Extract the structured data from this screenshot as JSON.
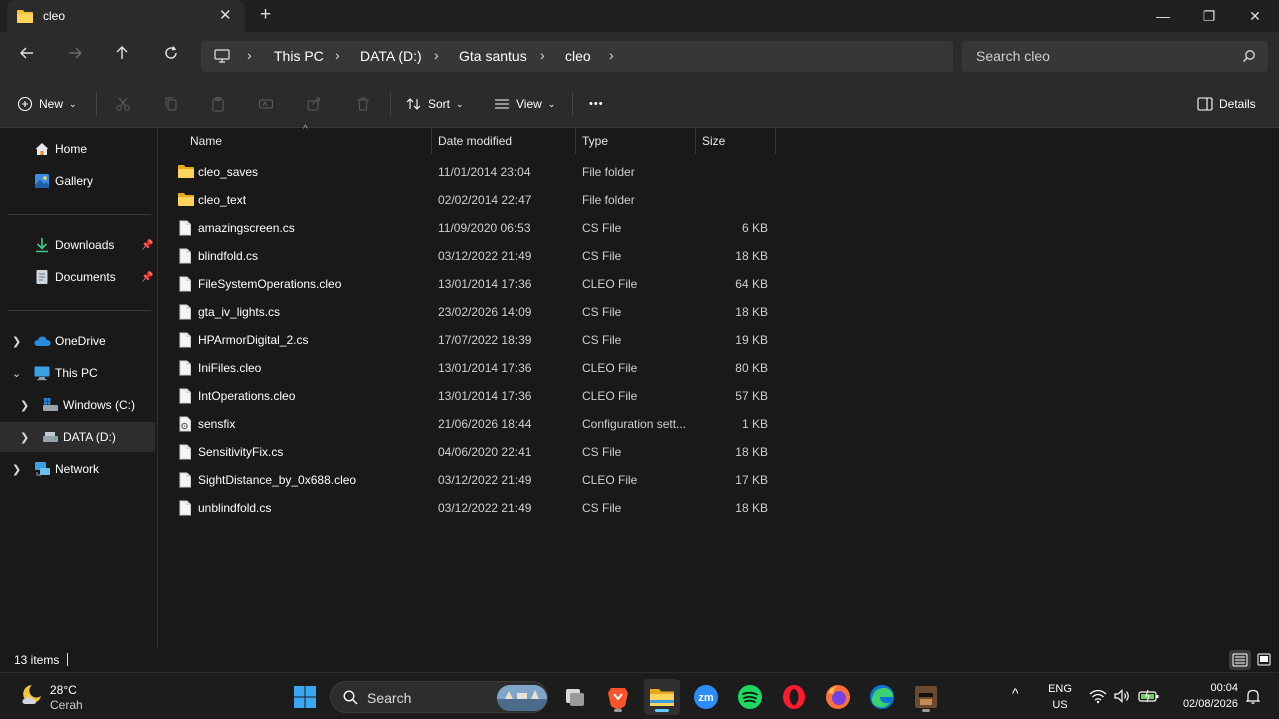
{
  "window": {
    "tab_title": "cleo",
    "new_tab_glyph": "+",
    "close_tab_glyph": "✕",
    "minimize_glyph": "—",
    "restore_glyph": "❐",
    "close_glyph": "✕"
  },
  "nav": {
    "breadcrumb": [
      "This PC",
      "DATA (D:)",
      "Gta santus",
      "cleo"
    ],
    "search_placeholder": "Search cleo"
  },
  "commands": {
    "new_label": "New",
    "sort_label": "Sort",
    "view_label": "View",
    "more_glyph": "•••",
    "details_label": "Details"
  },
  "sidebar": {
    "home": "Home",
    "gallery": "Gallery",
    "downloads": "Downloads",
    "documents": "Documents",
    "onedrive": "OneDrive",
    "thispc": "This PC",
    "windows_c": "Windows (C:)",
    "data_d": "DATA (D:)",
    "network": "Network"
  },
  "columns": {
    "name": "Name",
    "date": "Date modified",
    "type": "Type",
    "size": "Size"
  },
  "files": [
    {
      "name": "cleo_saves",
      "date": "11/01/2014 23:04",
      "type": "File folder",
      "size": "",
      "icon": "folder-icon"
    },
    {
      "name": "cleo_text",
      "date": "02/02/2014 22:47",
      "type": "File folder",
      "size": "",
      "icon": "folder-icon"
    },
    {
      "name": "amazingscreen.cs",
      "date": "11/09/2020 06:53",
      "type": "CS File",
      "size": "6 KB",
      "icon": "file-icon"
    },
    {
      "name": "blindfold.cs",
      "date": "03/12/2022 21:49",
      "type": "CS File",
      "size": "18 KB",
      "icon": "file-icon"
    },
    {
      "name": "FileSystemOperations.cleo",
      "date": "13/01/2014 17:36",
      "type": "CLEO File",
      "size": "64 KB",
      "icon": "file-icon"
    },
    {
      "name": "gta_iv_lights.cs",
      "date": "23/02/2026 14:09",
      "type": "CS File",
      "size": "18 KB",
      "icon": "file-icon"
    },
    {
      "name": "HPArmorDigital_2.cs",
      "date": "17/07/2022 18:39",
      "type": "CS File",
      "size": "19 KB",
      "icon": "file-icon"
    },
    {
      "name": "IniFiles.cleo",
      "date": "13/01/2014 17:36",
      "type": "CLEO File",
      "size": "80 KB",
      "icon": "file-icon"
    },
    {
      "name": "IntOperations.cleo",
      "date": "13/01/2014 17:36",
      "type": "CLEO File",
      "size": "57 KB",
      "icon": "file-icon"
    },
    {
      "name": "sensfix",
      "date": "21/06/2026 18:44",
      "type": "Configuration sett...",
      "size": "1 KB",
      "icon": "config-file-icon"
    },
    {
      "name": "SensitivityFix.cs",
      "date": "04/06/2020 22:41",
      "type": "CS File",
      "size": "18 KB",
      "icon": "file-icon"
    },
    {
      "name": "SightDistance_by_0x688.cleo",
      "date": "03/12/2022 21:49",
      "type": "CLEO File",
      "size": "17 KB",
      "icon": "file-icon"
    },
    {
      "name": "unblindfold.cs",
      "date": "03/12/2022 21:49",
      "type": "CS File",
      "size": "18 KB",
      "icon": "file-icon"
    }
  ],
  "status": {
    "item_count": "13 items"
  },
  "taskbar": {
    "weather_temp": "28°C",
    "weather_cond": "Cerah",
    "search_label": "Search",
    "lang_top": "ENG",
    "lang_bottom": "US",
    "time": "00:04",
    "date": "02/08/2026",
    "chevron_glyph": "^"
  },
  "colors": {
    "folder": "#f8c33b",
    "accent": "#60cdff",
    "window_bg": "#191919",
    "chrome_bg": "#2b2b2b"
  }
}
